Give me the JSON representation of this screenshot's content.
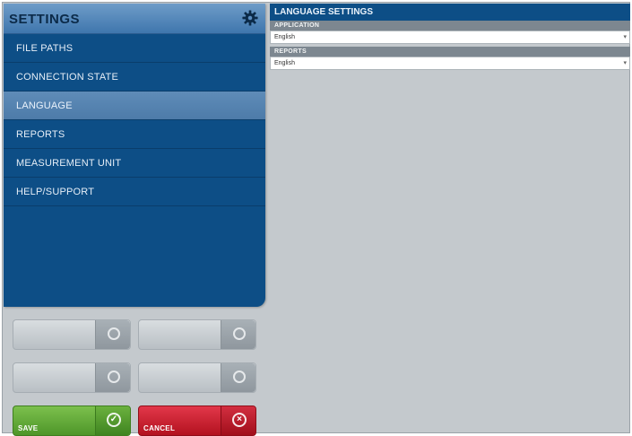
{
  "sidebar": {
    "title": "SETTINGS",
    "settings_icon": "gear-icon",
    "items": [
      {
        "label": "FILE PATHS",
        "active": false
      },
      {
        "label": "CONNECTION STATE",
        "active": false
      },
      {
        "label": "LANGUAGE",
        "active": true
      },
      {
        "label": "REPORTS",
        "active": false
      },
      {
        "label": "MEASUREMENT UNIT",
        "active": false
      },
      {
        "label": "HELP/SUPPORT",
        "active": false
      }
    ]
  },
  "buttons": {
    "save_label": "SAVE",
    "cancel_label": "CANCEL",
    "save_color": "#5aa334",
    "cancel_color": "#c81f2e"
  },
  "panel": {
    "title": "LANGUAGE SETTINGS",
    "application": {
      "label": "APPLICATION",
      "value": "English"
    },
    "reports": {
      "label": "REPORTS",
      "value": "English"
    }
  },
  "colors": {
    "primary": "#0d4e86",
    "active_item": "#5783b0",
    "background": "#c4c9cd"
  }
}
